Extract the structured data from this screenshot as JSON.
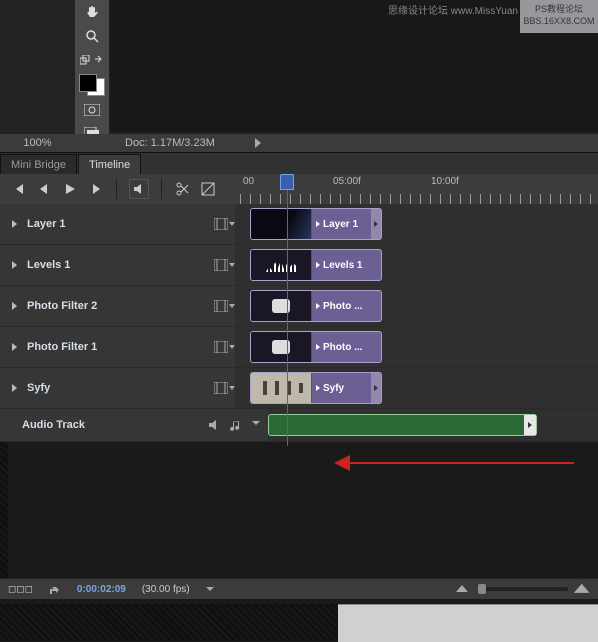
{
  "watermark": {
    "line1": "PS教程论坛",
    "line2": "BBS.16XX8.COM",
    "sub": "思缘设计论坛  www.MissYuan"
  },
  "status": {
    "zoom": "100%",
    "doc": "Doc: 1.17M/3.23M"
  },
  "tabs": {
    "mini_bridge": "Mini Bridge",
    "timeline": "Timeline"
  },
  "ruler": {
    "t0": "00",
    "t1": "05:00f",
    "t2": "10:00f"
  },
  "tracks": [
    {
      "name": "Layer 1",
      "clip_label": "Layer 1",
      "thumb": "grad",
      "endcap": true
    },
    {
      "name": "Levels 1",
      "clip_label": "Levels 1",
      "thumb": "eq",
      "endcap": false
    },
    {
      "name": "Photo Filter 2",
      "clip_label": "Photo ...",
      "thumb": "cam",
      "endcap": false
    },
    {
      "name": "Photo Filter 1",
      "clip_label": "Photo ...",
      "thumb": "cam",
      "endcap": false
    },
    {
      "name": "Syfy",
      "clip_label": "Syfy",
      "thumb": "syfy",
      "endcap": true
    }
  ],
  "audio": {
    "name": "Audio Track"
  },
  "bottom": {
    "frames_label": "◻◻◻",
    "time": "0:00:02:09",
    "fps": "(30.00 fps)"
  }
}
